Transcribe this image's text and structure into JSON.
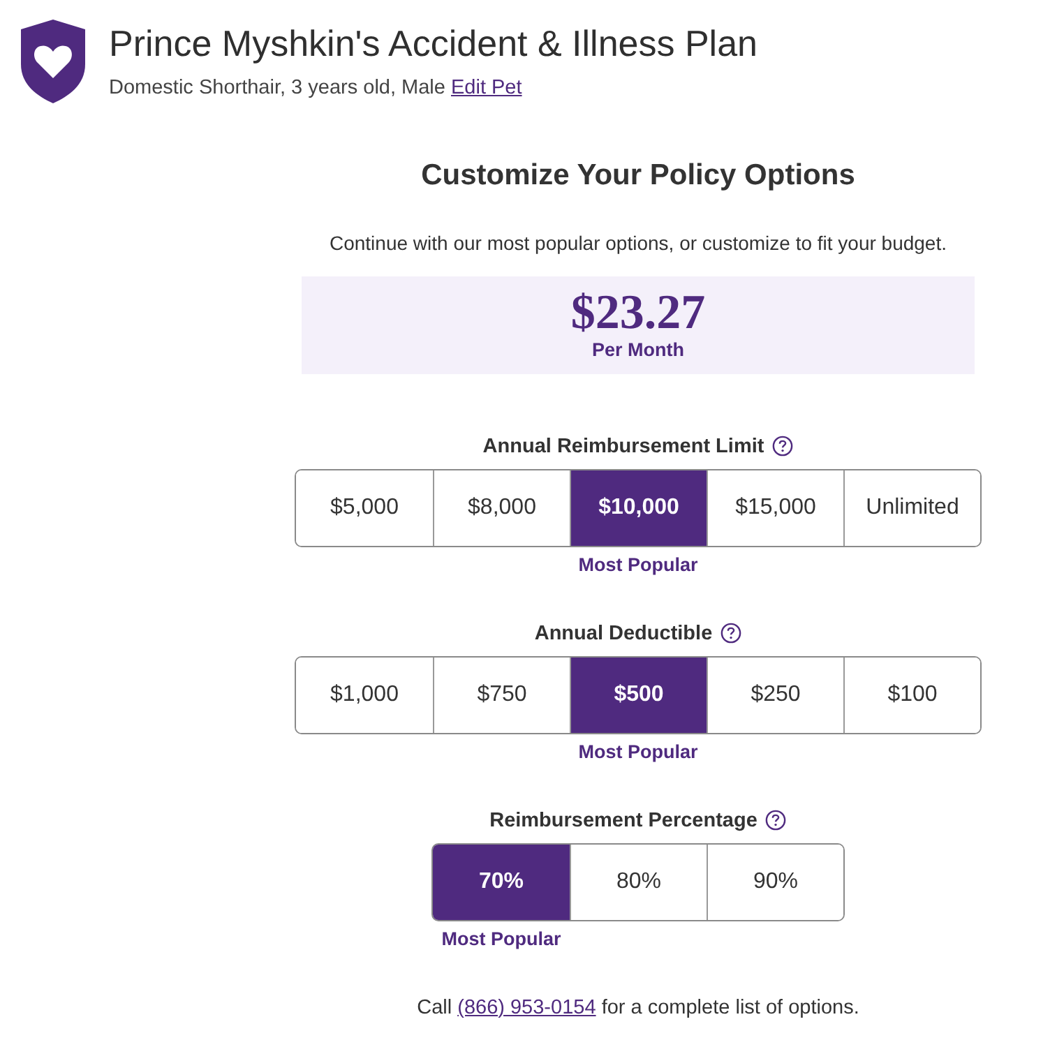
{
  "header": {
    "title": "Prince Myshkin's Accident & Illness Plan",
    "subtitle": "Domestic Shorthair, 3 years old, Male",
    "edit_link": "Edit Pet"
  },
  "heading": "Customize Your Policy Options",
  "intro": "Continue with our most popular options, or customize to fit your budget.",
  "price": {
    "amount": "$23.27",
    "period": "Per Month"
  },
  "groups": [
    {
      "label": "Annual Reimbursement Limit",
      "options": [
        {
          "label": "$5,000",
          "selected": false
        },
        {
          "label": "$8,000",
          "selected": false
        },
        {
          "label": "$10,000",
          "selected": true,
          "note": "Most Popular"
        },
        {
          "label": "$15,000",
          "selected": false
        },
        {
          "label": "Unlimited",
          "selected": false
        }
      ]
    },
    {
      "label": "Annual Deductible",
      "options": [
        {
          "label": "$1,000",
          "selected": false
        },
        {
          "label": "$750",
          "selected": false
        },
        {
          "label": "$500",
          "selected": true,
          "note": "Most Popular"
        },
        {
          "label": "$250",
          "selected": false
        },
        {
          "label": "$100",
          "selected": false
        }
      ]
    },
    {
      "label": "Reimbursement Percentage",
      "options": [
        {
          "label": "70%",
          "selected": true,
          "note": "Most Popular"
        },
        {
          "label": "80%",
          "selected": false
        },
        {
          "label": "90%",
          "selected": false
        }
      ]
    }
  ],
  "footer": {
    "prefix": "Call",
    "phone": "(866) 953-0154",
    "suffix": "for a complete list of options."
  }
}
